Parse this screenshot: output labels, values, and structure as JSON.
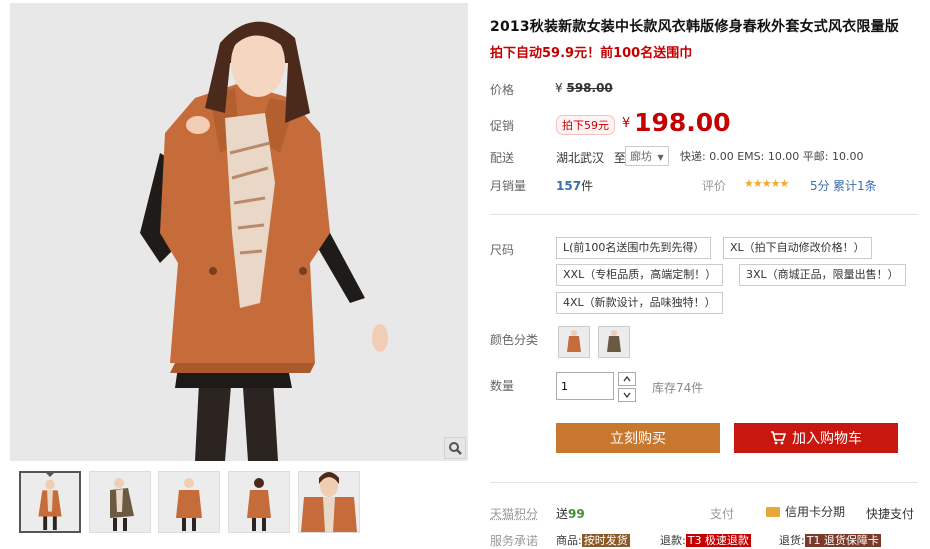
{
  "product": {
    "title": "2013秋装新款女装中长款风衣韩版修身春秋外套女式风衣限量版",
    "subtitle": "拍下自动59.9元！前100名送围巾"
  },
  "price": {
    "label": "价格",
    "currency": "¥",
    "original": "598.00"
  },
  "promo": {
    "label": "促销",
    "badge": "拍下59元",
    "currency": "¥",
    "price": "198.00"
  },
  "shipping": {
    "label": "配送",
    "from": "湖北武汉",
    "to_word": "至",
    "destination": "廊坊",
    "fees": "快递: 0.00 EMS: 10.00 平邮: 10.00"
  },
  "sales": {
    "label": "月销量",
    "count": "157",
    "unit": "件",
    "rating_label": "评价",
    "stars": "★★★★★",
    "score": "5分",
    "reviews": "累计1条"
  },
  "sizes": {
    "label": "尺码",
    "options": [
      "L(前100名送围巾先到先得）",
      "XL（拍下自动修改价格！）",
      "XXL（专柜品质，高端定制！）",
      "3XL（商城正品，限量出售！）",
      "4XL（新款设计，品味独特！）"
    ]
  },
  "color": {
    "label": "颜色分类"
  },
  "quantity": {
    "label": "数量",
    "value": "1",
    "stock": "库存74件"
  },
  "buttons": {
    "buy_now": "立刻购买",
    "add_to_cart": "加入购物车"
  },
  "points": {
    "label": "天猫积分",
    "prefix": "送",
    "value": "99",
    "pay_label": "支付",
    "credit": "信用卡分期",
    "quick": "快捷支付"
  },
  "service": {
    "label": "服务承诺",
    "items": [
      {
        "prefix": "商品:",
        "tag": "按时发货"
      },
      {
        "prefix": "退款:",
        "tag": "T3 极速退款"
      },
      {
        "prefix": "退货:",
        "tag": "T1 退货保障卡"
      }
    ]
  },
  "colors": {
    "price_red": "#c40000",
    "buy_button": "#c8772e",
    "cart_button": "#c7170f",
    "coat_orange": "#c56c3a"
  }
}
